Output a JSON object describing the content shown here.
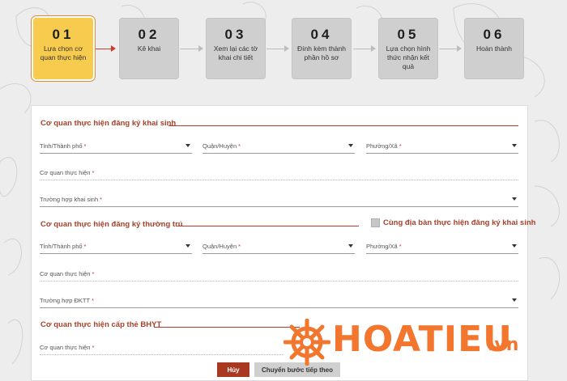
{
  "steps": [
    {
      "num": "01",
      "label": "Lựa chọn cơ quan thực hiện"
    },
    {
      "num": "02",
      "label": "Kê khai"
    },
    {
      "num": "03",
      "label": "Xem lại các tờ khai chi tiết"
    },
    {
      "num": "04",
      "label": "Đính kèm thành phần hồ sơ"
    },
    {
      "num": "05",
      "label": "Lựa chọn hình thức nhận kết quả"
    },
    {
      "num": "06",
      "label": "Hoàn thành"
    }
  ],
  "section1": {
    "title": "Cơ quan thực hiện đăng ký khai sinh",
    "province": "Tỉnh/Thành phố",
    "district": "Quận/Huyện",
    "ward": "Phường/Xã",
    "agency": "Cơ quan thực hiện",
    "case": "Trường hợp khai sinh"
  },
  "section2": {
    "title": "Cơ quan thực hiện đăng ký thường trú",
    "same_area_label": "Cùng địa bàn thực hiện đăng ký khai sinh",
    "province": "Tỉnh/Thành phố",
    "district": "Quận/Huyện",
    "ward": "Phường/Xã",
    "agency": "Cơ quan thực hiện",
    "case": "Trường hợp ĐKTT"
  },
  "section3": {
    "title": "Cơ quan thực hiện cấp thẻ BHYT",
    "agency": "Cơ quan thực hiện"
  },
  "buttons": {
    "cancel": "Hủy",
    "next": "Chuyển bước tiếp theo"
  },
  "watermark": {
    "brand": "HOATIEU",
    "suffix": ".vn",
    "color": "#f2762e"
  },
  "required_mark": "*",
  "colors": {
    "active_step": "#f7cb4d",
    "accent": "#a8412b",
    "cancel_button": "#a8381f"
  }
}
